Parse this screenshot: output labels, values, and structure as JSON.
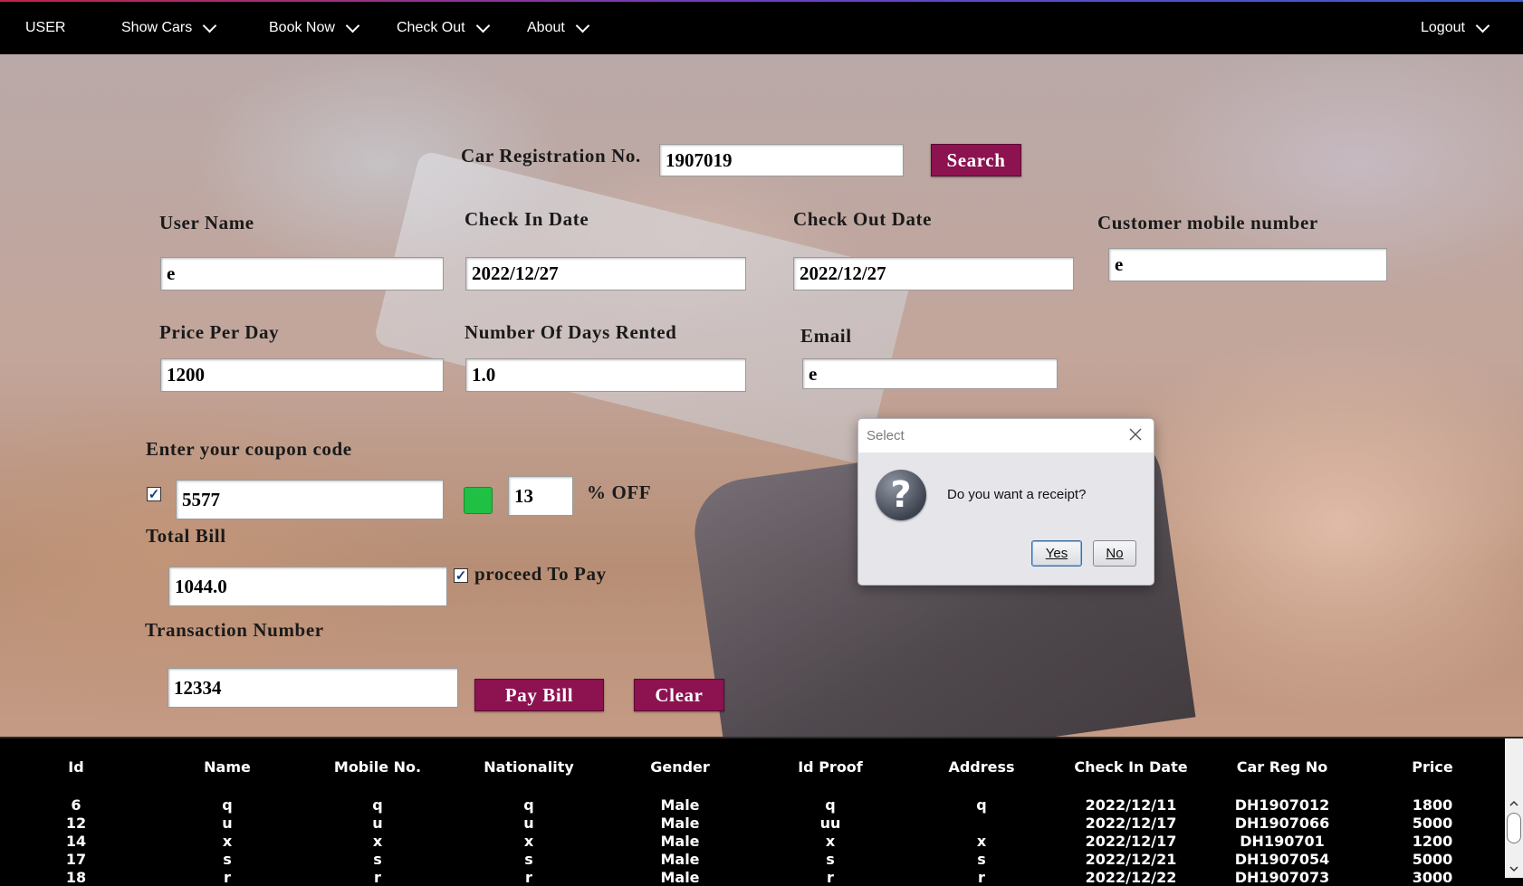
{
  "menu": {
    "user": "USER",
    "show_cars": "Show Cars",
    "book_now": "Book Now",
    "check_out": "Check Out",
    "about": "About",
    "logout": "Logout"
  },
  "form": {
    "car_reg_label": "Car Registration No.",
    "car_reg_value": "1907019",
    "search_label": "Search",
    "user_name_label": "User Name",
    "user_name_value": "e",
    "check_in_label": "Check In Date",
    "check_in_value": "2022/12/27",
    "check_out_label": "Check Out Date",
    "check_out_value": "2022/12/27",
    "mobile_label": "Customer mobile number",
    "mobile_value": "e",
    "price_label": "Price Per Day",
    "price_value": "1200",
    "days_label": "Number Of Days Rented",
    "days_value": "1.0",
    "email_label": "Email",
    "email_value": "e",
    "coupon_label": "Enter your coupon code",
    "coupon_value": "5577",
    "discount_value": "13",
    "off_label": "% OFF",
    "total_label": "Total Bill",
    "total_value": "1044.0",
    "proceed_label": "proceed To Pay",
    "txn_label": "Transaction Number",
    "txn_value": "12334",
    "pay_label": "Pay Bill",
    "clear_label": "Clear"
  },
  "dialog": {
    "title": "Select",
    "message": "Do you want a receipt?",
    "yes": "Yes",
    "no": "No"
  },
  "table": {
    "headers": [
      "Id",
      "Name",
      "Mobile No.",
      "Nationality",
      "Gender",
      "Id Proof",
      "Address",
      "Check In Date",
      "Car Reg No",
      "Price"
    ],
    "rows": [
      [
        "6",
        "q",
        "q",
        "q",
        "Male",
        "q",
        "q",
        "2022/12/11",
        "DH1907012",
        "1800"
      ],
      [
        "12",
        "u",
        "u",
        "u",
        "Male",
        "uu",
        "",
        "2022/12/17",
        "DH1907066",
        "5000"
      ],
      [
        "14",
        "x",
        "x",
        "x",
        "Male",
        "x",
        "x",
        "2022/12/17",
        "DH190701",
        "1200"
      ],
      [
        "17",
        "s",
        "s",
        "s",
        "Male",
        "s",
        "s",
        "2022/12/21",
        "DH1907054",
        "5000"
      ],
      [
        "18",
        "r",
        "r",
        "r",
        "Male",
        "r",
        "r",
        "2022/12/22",
        "DH1907073",
        "3000"
      ]
    ]
  },
  "colors": {
    "button": "#8c1250",
    "menu_bg": "#000000",
    "check_green": "#1fc043"
  }
}
